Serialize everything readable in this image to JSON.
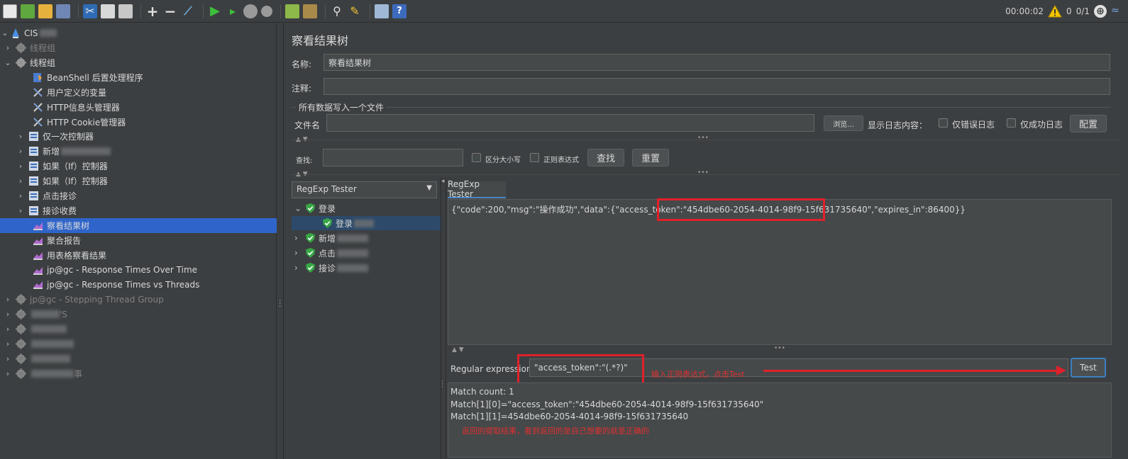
{
  "toolbar": {
    "icons": [
      "new-icon",
      "templates-icon",
      "open-icon",
      "save-icon",
      "cut-icon",
      "copy-icon",
      "paste-icon",
      "expand-icon",
      "collapse-icon",
      "toggle-icon",
      "start-icon",
      "start-no-pauses-icon",
      "stop-icon",
      "shutdown-icon",
      "clear-icon",
      "clear-all-icon",
      "search-icon",
      "reset-search-icon",
      "function-helper-icon",
      "help-icon"
    ],
    "plus": "+",
    "minus": "−",
    "help": "?"
  },
  "status": {
    "elapsed": "00:00:02",
    "warnings": "0",
    "threads": "0/1"
  },
  "tree": {
    "root": "CIS",
    "items": [
      {
        "label": "线程组",
        "dim": true
      },
      {
        "label": "线程组"
      },
      {
        "label": "BeanShell 后置处理程序"
      },
      {
        "label": "用户定义的变量"
      },
      {
        "label": "HTTP信息头管理器"
      },
      {
        "label": "HTTP Cookie管理器"
      },
      {
        "label": "仅一次控制器"
      },
      {
        "label": "新增"
      },
      {
        "label": "如果（If）控制器"
      },
      {
        "label": "如果（If）控制器"
      },
      {
        "label": "点击接诊"
      },
      {
        "label": "接诊收费"
      },
      {
        "label": "察看结果树",
        "selected": true
      },
      {
        "label": "聚合报告"
      },
      {
        "label": "用表格察看结果"
      },
      {
        "label": "jp@gc - Response Times Over Time"
      },
      {
        "label": "jp@gc - Response Times vs Threads"
      },
      {
        "label": "jp@gc - Stepping Thread Group",
        "dim": true
      },
      {
        "label": "'S",
        "dim": true
      },
      {
        "label": "",
        "dim": true
      },
      {
        "label": "",
        "dim": true
      },
      {
        "label": "",
        "dim": true
      },
      {
        "label": "事",
        "dim": true
      }
    ]
  },
  "panel": {
    "title": "察看结果树",
    "name_label": "名称:",
    "name_value": "察看结果树",
    "comment_label": "注释:",
    "comment_value": "",
    "file_section": "所有数据写入一个文件",
    "file_label": "文件名",
    "file_value": "",
    "browse": "浏览...",
    "log_label": "显示日志内容：",
    "errors_only": "仅错误日志",
    "success_only": "仅成功日志",
    "configure": "配置",
    "search_label": "查找:",
    "search_value": "",
    "case_sensitive": "区分大小写",
    "regex": "正则表达式",
    "find": "查找",
    "reset": "重置"
  },
  "results": {
    "renderer": "RegExp Tester",
    "samples": [
      {
        "label": "登录",
        "expanded": true
      },
      {
        "label": "登录",
        "child": true,
        "selected": true
      },
      {
        "label": "新增"
      },
      {
        "label": "点击"
      },
      {
        "label": "接诊"
      }
    ]
  },
  "tester": {
    "tab": "RegExp Tester",
    "response": "{\"code\":200,\"msg\":\"操作成功\",\"data\":{\"access_token\":\"454dbe60-2054-4014-98f9-15f631735640\",\"expires_in\":86400}}",
    "regex_label": "Regular expression:",
    "regex_value": "\"access_token\":\"(.*?)\"",
    "test_button": "Test",
    "match_count": "Match count: 1",
    "match_1_0": "Match[1][0]=\"access_token\":\"454dbe60-2054-4014-98f9-15f631735640\"",
    "match_1_1": "Match[1][1]=454dbe60-2054-4014-98f9-15f631735640"
  },
  "annotations": {
    "input_hint": "输入正则表达式，点击Test",
    "result_hint": "返回的提取结果，看到返回的是自己想要的就是正确的",
    "color": "#e0202a"
  },
  "colors": {
    "background": "#3c3f41",
    "selection": "#2f65ca",
    "field": "#45494a"
  }
}
